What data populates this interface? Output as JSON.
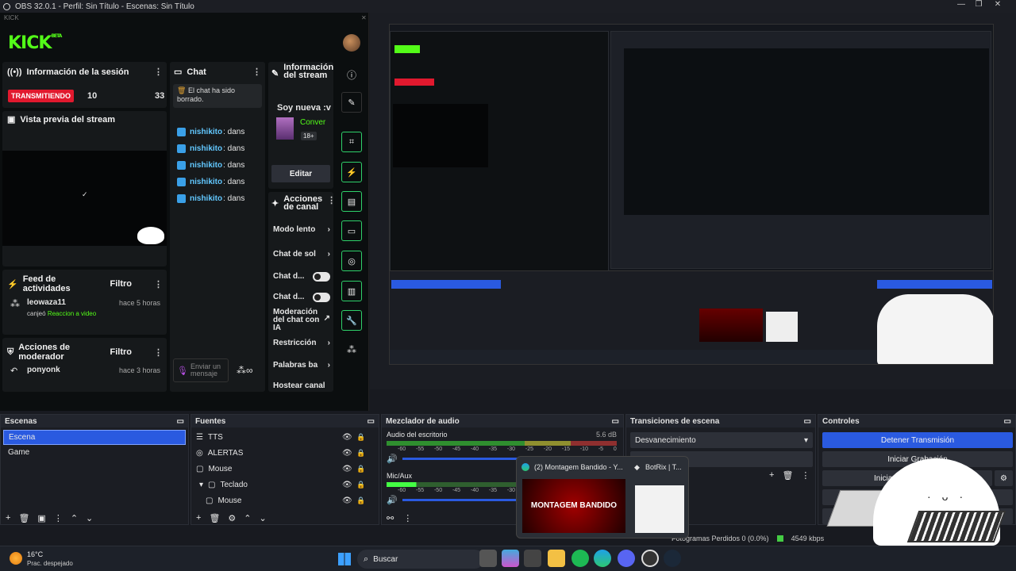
{
  "window": {
    "title": "OBS 32.0.1 - Perfil: Sin Título - Escenas: Sin Título",
    "minimize": "—",
    "maximize": "❐",
    "close": "✕"
  },
  "kick": {
    "sub_title": "KICK",
    "logo": "KICK",
    "logo_beta": "BETA",
    "session": {
      "title": "Información de la sesión",
      "live_label": "TRANSMITIENDO",
      "viewers": "10",
      "followers": "33"
    },
    "preview_title": "Vista previa del stream",
    "chat": {
      "title": "Chat",
      "deleted_msg": "El chat ha sido borrado.",
      "messages": [
        {
          "user": "nishikito",
          "text": ": dans"
        },
        {
          "user": "nishikito",
          "text": ": dans"
        },
        {
          "user": "nishikito",
          "text": ": dans"
        },
        {
          "user": "nishikito",
          "text": ": dans"
        },
        {
          "user": "nishikito",
          "text": ": dans"
        }
      ],
      "input_placeholder": "Enviar un mensaje"
    },
    "stream_info": {
      "title": "Información del stream",
      "stream_title": "Soy nueva :v",
      "category": "Conver",
      "age": "18+",
      "edit_button": "Editar"
    },
    "channel_actions": {
      "title": "Acciones de canal",
      "items": [
        "Modo lento",
        "Chat de sol",
        "Chat d...",
        "Chat d...",
        "Moderación del chat con IA",
        "Restricción",
        "Palabras ba",
        "Hostear canal"
      ]
    },
    "feed": {
      "title": "Feed de actividades",
      "filter": "Filtro",
      "items": [
        {
          "user": "leowaza11",
          "action": "canjeó",
          "reward": "Reaccion a video",
          "time": "hace 5 horas"
        }
      ]
    },
    "mod_actions": {
      "title": "Acciones de moderador",
      "filter": "Filtro",
      "items": [
        {
          "user": "ponyonk",
          "time": "hace 3 horas"
        }
      ]
    }
  },
  "docks": {
    "scenes": {
      "title": "Escenas",
      "items": [
        "Escena",
        "Game"
      ]
    },
    "sources": {
      "title": "Fuentes",
      "items": [
        {
          "label": "TTS",
          "indent": 0,
          "icon": "text-icon"
        },
        {
          "label": "ALERTAS",
          "indent": 0,
          "icon": "browser-icon"
        },
        {
          "label": "Mouse",
          "indent": 0,
          "icon": "folder-icon"
        },
        {
          "label": "Teclado",
          "indent": 1,
          "icon": "folder-icon"
        },
        {
          "label": "Mouse",
          "indent": 2,
          "icon": "folder-icon"
        }
      ]
    },
    "mixer": {
      "title": "Mezclador de audio",
      "channels": [
        {
          "name": "Audio del escritorio",
          "db": "5.6 dB"
        },
        {
          "name": "Mic/Aux",
          "db": ""
        }
      ],
      "scale": [
        "-60",
        "-55",
        "-50",
        "-45",
        "-40",
        "-35",
        "-30",
        "-25",
        "-20",
        "-15",
        "-10",
        "-5",
        "0"
      ]
    },
    "transitions": {
      "title": "Transiciones de escena",
      "selected": "Desvanecimiento"
    },
    "controls": {
      "title": "Controles",
      "stop_stream": "Detener Transmisión",
      "start_recording": "Iniciar Grabación",
      "virtual_cam": "Iniciar"
    }
  },
  "status": {
    "dropped": "Fotogramas Perdidos 0 (0.0%)",
    "bitrate": "4549 kbps"
  },
  "hover_previews": [
    {
      "title": "(2) Montagem Bandido - Y...",
      "image_text": "MONTAGEM BANDIDO"
    },
    {
      "title": "BotRix | T..."
    }
  ],
  "taskbar": {
    "weather_temp": "16°C",
    "weather_desc": "Prac. despejado",
    "search": "Buscar"
  },
  "colors": {
    "kick_green": "#53fc18",
    "live_red": "#e1192e",
    "obs_blue": "#2a5ae0",
    "panel_bg": "#16191b"
  }
}
